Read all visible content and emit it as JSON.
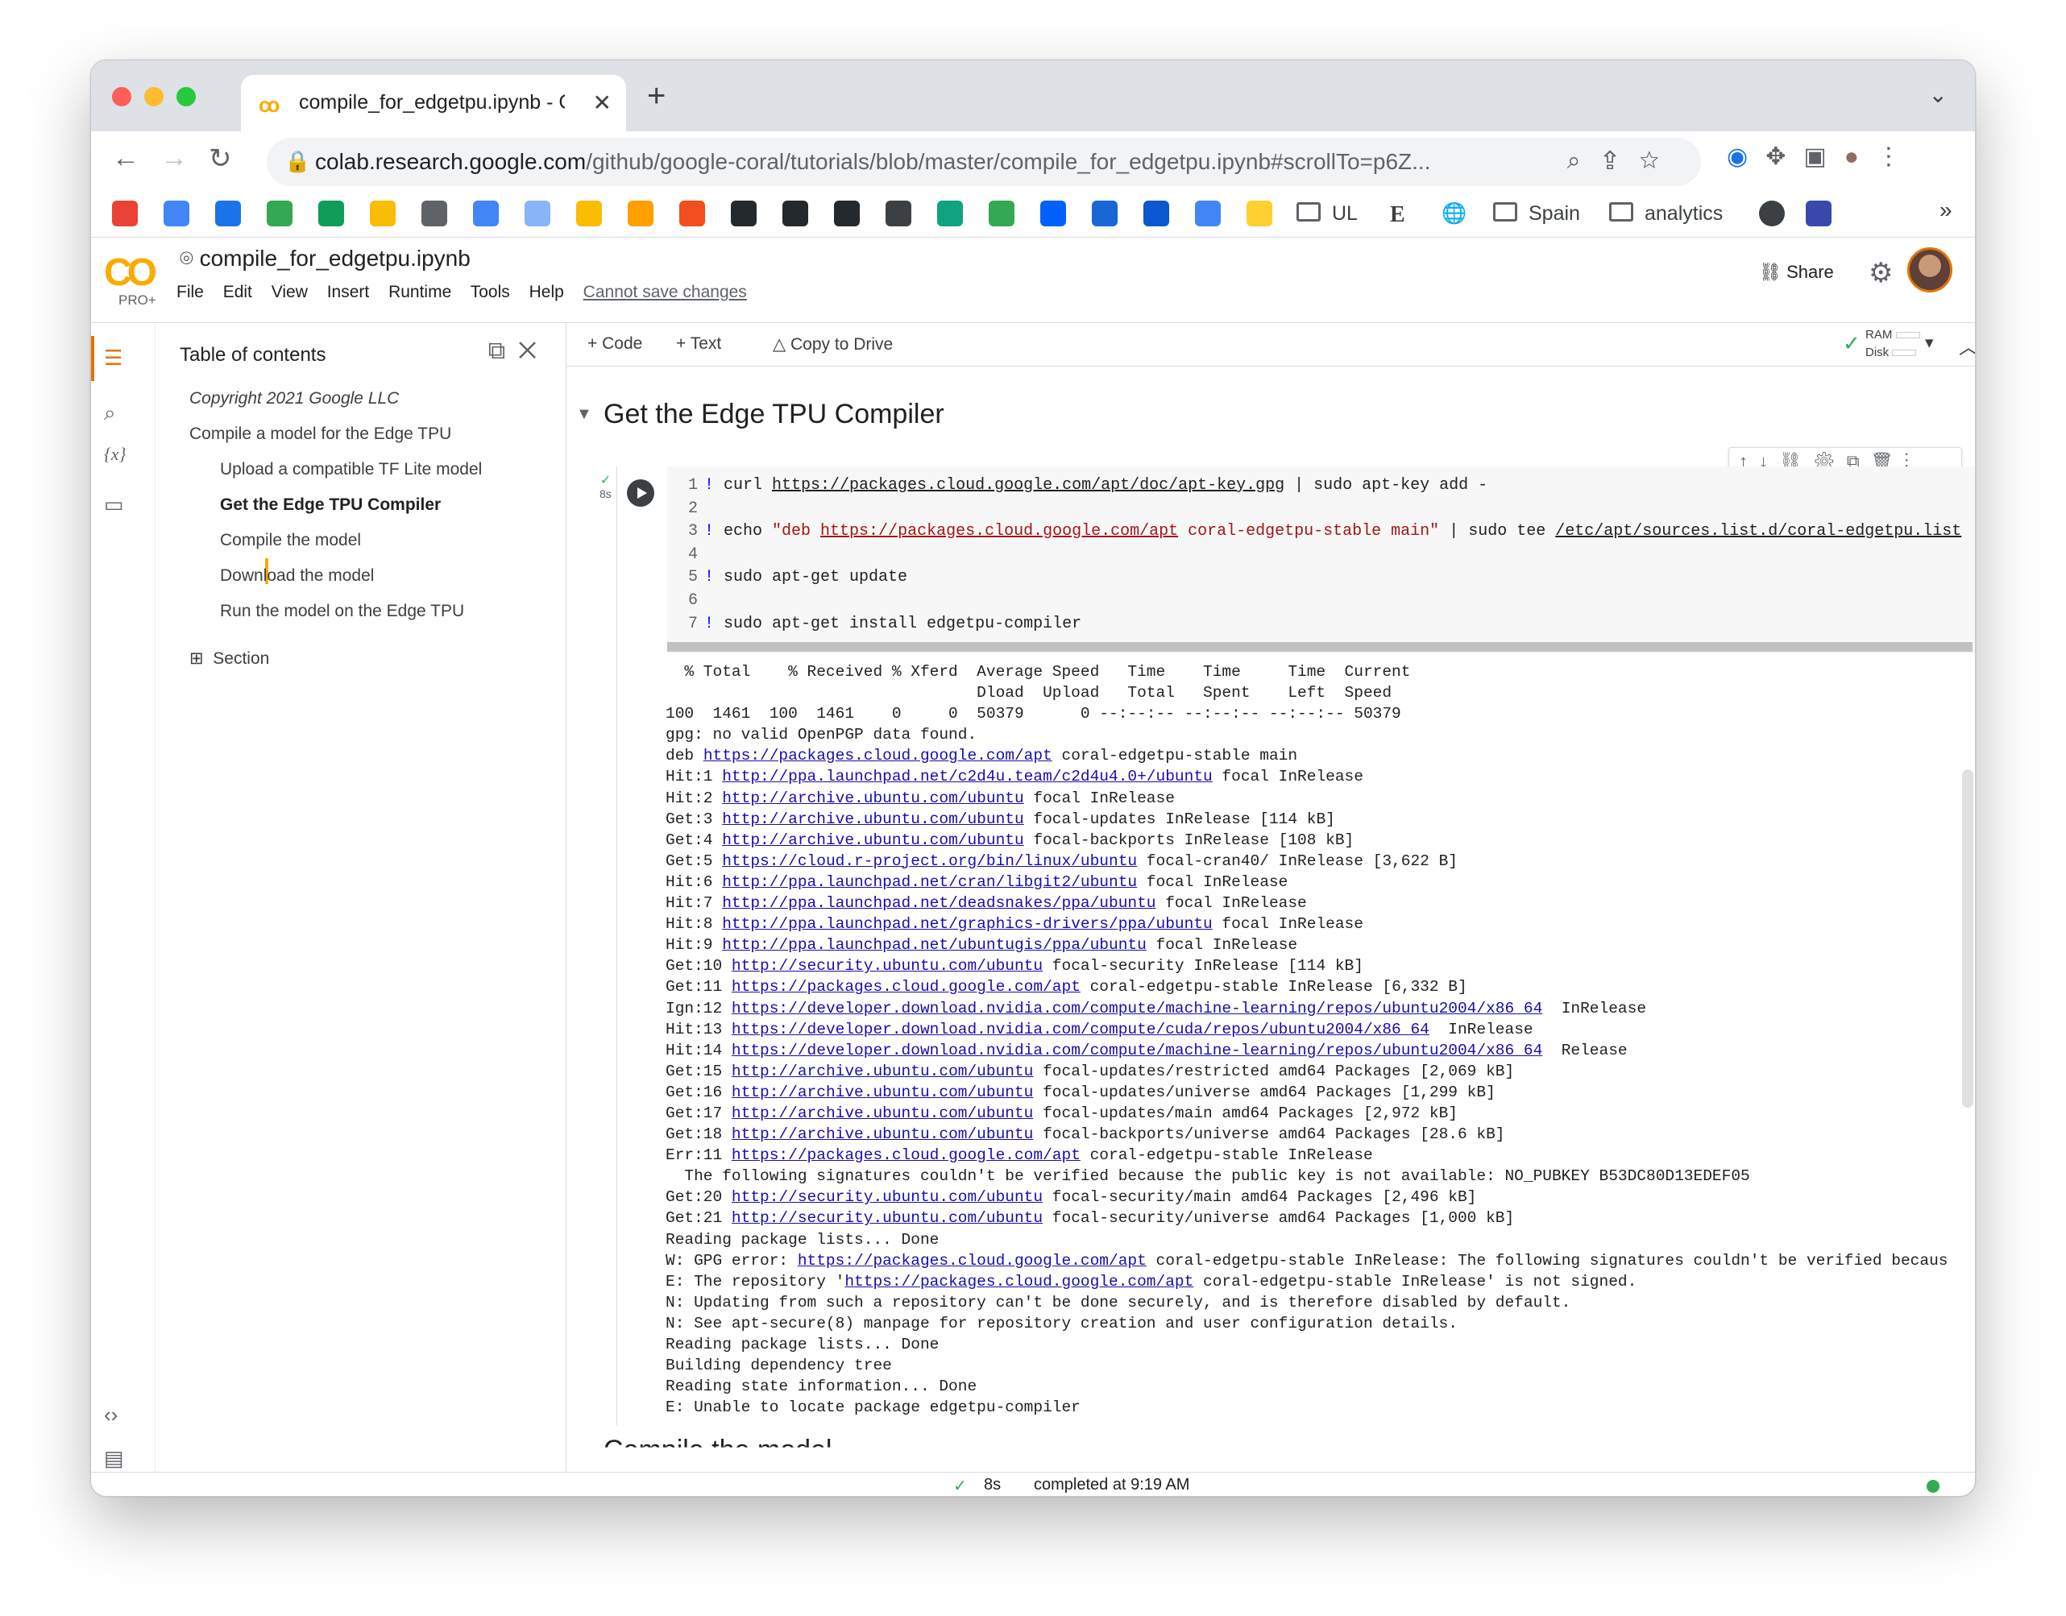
{
  "browser": {
    "tab_title": "compile_for_edgetpu.ipynb - C",
    "tab_close": "✕",
    "new_tab": "+",
    "tab_menu": "⌄",
    "url_domain": "colab.research.google.com",
    "url_path": "/github/google-coral/tutorials/blob/master/compile_for_edgetpu.ipynb#scrollTo=p6Z..."
  },
  "bookmarks": [
    {
      "name": "gmail",
      "color": "#ea4335"
    },
    {
      "name": "calendar",
      "color": "#4285f4"
    },
    {
      "name": "chrome",
      "color": "#1a73e8"
    },
    {
      "name": "drive",
      "color": "#34a853"
    },
    {
      "name": "sheets",
      "color": "#0f9d58"
    },
    {
      "name": "box",
      "color": "#fbbc04"
    },
    {
      "name": "settings",
      "color": "#5f6368"
    },
    {
      "name": "table",
      "color": "#4285f4"
    },
    {
      "name": "code",
      "color": "#8ab4f8"
    },
    {
      "name": "dots",
      "color": "#fbbc04"
    },
    {
      "name": "firebase",
      "color": "#ffa000"
    },
    {
      "name": "figma",
      "color": "#f24e1e"
    },
    {
      "name": "github",
      "color": "#24292e"
    },
    {
      "name": "github-2",
      "color": "#24292e"
    },
    {
      "name": "github-3",
      "color": "#24292e"
    },
    {
      "name": "stack",
      "color": "#3c4043"
    },
    {
      "name": "openai",
      "color": "#10a37f"
    },
    {
      "name": "tasks",
      "color": "#34a853"
    },
    {
      "name": "butterfly",
      "color": "#0061ff"
    },
    {
      "name": "blue-a",
      "color": "#1967d2"
    },
    {
      "name": "blue-b",
      "color": "#0b57d0"
    },
    {
      "name": "blue-c",
      "color": "#4285f4"
    },
    {
      "name": "miro",
      "color": "#ffd02f"
    }
  ],
  "bookmark_labels": {
    "ul": "UL",
    "e": "E",
    "spain": "Spain",
    "analytics": "analytics",
    "overflow": "»"
  },
  "colab": {
    "logo": "CO",
    "pro": "PRO+",
    "notebook_title": "compile_for_edgetpu.ipynb",
    "menus": [
      "File",
      "Edit",
      "View",
      "Insert",
      "Runtime",
      "Tools",
      "Help"
    ],
    "cannot_save": "Cannot save changes",
    "share": "Share"
  },
  "toolbar": {
    "add_code": "+ Code",
    "add_text": "+ Text",
    "copy_to_drive": "Copy to Drive",
    "ram": "RAM",
    "disk": "Disk"
  },
  "toc": {
    "title": "Table of contents",
    "items": [
      {
        "label": "Copyright 2021 Google LLC"
      },
      {
        "label": "Compile a model for the Edge TPU"
      },
      {
        "label": "Upload a compatible TF Lite model"
      },
      {
        "label": "Get the Edge TPU Compiler"
      },
      {
        "label": "Compile the model"
      },
      {
        "label": "Download the model"
      },
      {
        "label": "Run the model on the Edge TPU"
      }
    ],
    "section_label": "Section"
  },
  "notebook": {
    "section_heading": "Get the Edge TPU Compiler",
    "exec_time": "8s",
    "next_section": "Compile the model"
  },
  "code": {
    "lines": [
      {
        "n": "1",
        "parts": [
          {
            "t": "! ",
            "c": "bang"
          },
          {
            "t": "curl "
          },
          {
            "t": "https://packages.cloud.google.com/apt/doc/apt-key.gpg",
            "c": "u"
          },
          {
            "t": " | sudo apt-key add -"
          }
        ]
      },
      {
        "n": "2",
        "parts": []
      },
      {
        "n": "3",
        "parts": [
          {
            "t": "! ",
            "c": "bang"
          },
          {
            "t": "echo "
          },
          {
            "t": "\"deb ",
            "c": "str"
          },
          {
            "t": "https://packages.cloud.google.com/apt",
            "c": "str u"
          },
          {
            "t": " coral-edgetpu-stable main\"",
            "c": "str"
          },
          {
            "t": " | sudo tee "
          },
          {
            "t": "/etc/apt/sources.list.d/coral-edgetpu.list",
            "c": "u"
          }
        ]
      },
      {
        "n": "4",
        "parts": []
      },
      {
        "n": "5",
        "parts": [
          {
            "t": "! ",
            "c": "bang"
          },
          {
            "t": "sudo apt-get update"
          }
        ]
      },
      {
        "n": "6",
        "parts": []
      },
      {
        "n": "7",
        "parts": [
          {
            "t": "! ",
            "c": "bang"
          },
          {
            "t": "sudo apt-get install edgetpu-compiler"
          }
        ]
      }
    ]
  },
  "output": {
    "lines": [
      [
        {
          "t": "  % Total    % Received % Xferd  Average Speed   Time    Time     Time  Current"
        }
      ],
      [
        {
          "t": "                                 Dload  Upload   Total   Spent    Left  Speed"
        }
      ],
      [
        {
          "t": "100  1461  100  1461    0     0  50379      0 --:--:-- --:--:-- --:--:-- 50379"
        }
      ],
      [
        {
          "t": "gpg: no valid OpenPGP data found."
        }
      ],
      [
        {
          "t": "deb "
        },
        {
          "t": "https://packages.cloud.google.com/apt",
          "l": 1
        },
        {
          "t": " coral-edgetpu-stable main"
        }
      ],
      [
        {
          "t": "Hit:1 "
        },
        {
          "t": "http://ppa.launchpad.net/c2d4u.team/c2d4u4.0+/ubuntu",
          "l": 1
        },
        {
          "t": " focal InRelease"
        }
      ],
      [
        {
          "t": "Hit:2 "
        },
        {
          "t": "http://archive.ubuntu.com/ubuntu",
          "l": 1
        },
        {
          "t": " focal InRelease"
        }
      ],
      [
        {
          "t": "Get:3 "
        },
        {
          "t": "http://archive.ubuntu.com/ubuntu",
          "l": 1
        },
        {
          "t": " focal-updates InRelease [114 kB]"
        }
      ],
      [
        {
          "t": "Get:4 "
        },
        {
          "t": "http://archive.ubuntu.com/ubuntu",
          "l": 1
        },
        {
          "t": " focal-backports InRelease [108 kB]"
        }
      ],
      [
        {
          "t": "Get:5 "
        },
        {
          "t": "https://cloud.r-project.org/bin/linux/ubuntu",
          "l": 1
        },
        {
          "t": " focal-cran40/ InRelease [3,622 B]"
        }
      ],
      [
        {
          "t": "Hit:6 "
        },
        {
          "t": "http://ppa.launchpad.net/cran/libgit2/ubuntu",
          "l": 1
        },
        {
          "t": " focal InRelease"
        }
      ],
      [
        {
          "t": "Hit:7 "
        },
        {
          "t": "http://ppa.launchpad.net/deadsnakes/ppa/ubuntu",
          "l": 1
        },
        {
          "t": " focal InRelease"
        }
      ],
      [
        {
          "t": "Hit:8 "
        },
        {
          "t": "http://ppa.launchpad.net/graphics-drivers/ppa/ubuntu",
          "l": 1
        },
        {
          "t": " focal InRelease"
        }
      ],
      [
        {
          "t": "Hit:9 "
        },
        {
          "t": "http://ppa.launchpad.net/ubuntugis/ppa/ubuntu",
          "l": 1
        },
        {
          "t": " focal InRelease"
        }
      ],
      [
        {
          "t": "Get:10 "
        },
        {
          "t": "http://security.ubuntu.com/ubuntu",
          "l": 1
        },
        {
          "t": " focal-security InRelease [114 kB]"
        }
      ],
      [
        {
          "t": "Get:11 "
        },
        {
          "t": "https://packages.cloud.google.com/apt",
          "l": 1
        },
        {
          "t": " coral-edgetpu-stable InRelease [6,332 B]"
        }
      ],
      [
        {
          "t": "Ign:12 "
        },
        {
          "t": "https://developer.download.nvidia.com/compute/machine-learning/repos/ubuntu2004/x86_64",
          "l": 1
        },
        {
          "t": "  InRelease"
        }
      ],
      [
        {
          "t": "Hit:13 "
        },
        {
          "t": "https://developer.download.nvidia.com/compute/cuda/repos/ubuntu2004/x86_64",
          "l": 1
        },
        {
          "t": "  InRelease"
        }
      ],
      [
        {
          "t": "Hit:14 "
        },
        {
          "t": "https://developer.download.nvidia.com/compute/machine-learning/repos/ubuntu2004/x86_64",
          "l": 1
        },
        {
          "t": "  Release"
        }
      ],
      [
        {
          "t": "Get:15 "
        },
        {
          "t": "http://archive.ubuntu.com/ubuntu",
          "l": 1
        },
        {
          "t": " focal-updates/restricted amd64 Packages [2,069 kB]"
        }
      ],
      [
        {
          "t": "Get:16 "
        },
        {
          "t": "http://archive.ubuntu.com/ubuntu",
          "l": 1
        },
        {
          "t": " focal-updates/universe amd64 Packages [1,299 kB]"
        }
      ],
      [
        {
          "t": "Get:17 "
        },
        {
          "t": "http://archive.ubuntu.com/ubuntu",
          "l": 1
        },
        {
          "t": " focal-updates/main amd64 Packages [2,972 kB]"
        }
      ],
      [
        {
          "t": "Get:18 "
        },
        {
          "t": "http://archive.ubuntu.com/ubuntu",
          "l": 1
        },
        {
          "t": " focal-backports/universe amd64 Packages [28.6 kB]"
        }
      ],
      [
        {
          "t": "Err:11 "
        },
        {
          "t": "https://packages.cloud.google.com/apt",
          "l": 1
        },
        {
          "t": " coral-edgetpu-stable InRelease"
        }
      ],
      [
        {
          "t": "  The following signatures couldn't be verified because the public key is not available: NO_PUBKEY B53DC80D13EDEF05"
        }
      ],
      [
        {
          "t": "Get:20 "
        },
        {
          "t": "http://security.ubuntu.com/ubuntu",
          "l": 1
        },
        {
          "t": " focal-security/main amd64 Packages [2,496 kB]"
        }
      ],
      [
        {
          "t": "Get:21 "
        },
        {
          "t": "http://security.ubuntu.com/ubuntu",
          "l": 1
        },
        {
          "t": " focal-security/universe amd64 Packages [1,000 kB]"
        }
      ],
      [
        {
          "t": "Reading package lists... Done"
        }
      ],
      [
        {
          "t": "W: GPG error: "
        },
        {
          "t": "https://packages.cloud.google.com/apt",
          "l": 1
        },
        {
          "t": " coral-edgetpu-stable InRelease: The following signatures couldn't be verified becaus"
        }
      ],
      [
        {
          "t": "E: The repository '"
        },
        {
          "t": "https://packages.cloud.google.com/apt",
          "l": 1
        },
        {
          "t": " coral-edgetpu-stable InRelease' is not signed."
        }
      ],
      [
        {
          "t": "N: Updating from such a repository can't be done securely, and is therefore disabled by default."
        }
      ],
      [
        {
          "t": "N: See apt-secure(8) manpage for repository creation and user configuration details."
        }
      ],
      [
        {
          "t": "Reading package lists... Done"
        }
      ],
      [
        {
          "t": "Building dependency tree"
        }
      ],
      [
        {
          "t": "Reading state information... Done"
        }
      ],
      [
        {
          "t": "E: Unable to locate package edgetpu-compiler"
        }
      ]
    ]
  },
  "status": {
    "check": "✓",
    "time": "8s",
    "completed": "completed at 9:19 AM"
  }
}
